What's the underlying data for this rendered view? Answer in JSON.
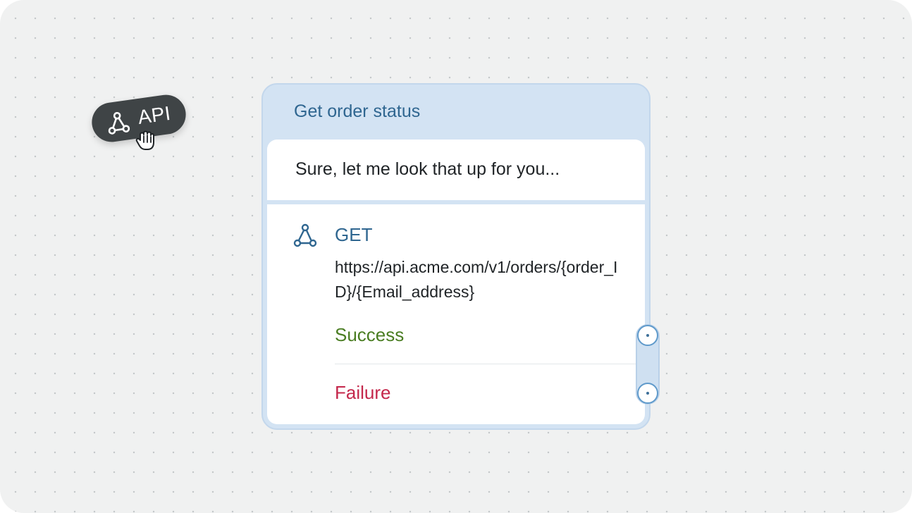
{
  "chip": {
    "label": "API",
    "icon": "api-webhook-icon"
  },
  "cursor": {
    "icon": "grab-hand-cursor-icon"
  },
  "node": {
    "title": "Get order status",
    "message": "Sure, let me look that up for you...",
    "api": {
      "icon": "api-webhook-icon",
      "method": "GET",
      "url": "https://api.acme.com/v1/orders/{order_ID}/{Email_address}"
    },
    "outcomes": {
      "success": "Success",
      "failure": "Failure"
    }
  },
  "colors": {
    "canvas": "#f0f1f1",
    "node_header": "#d3e3f3",
    "title": "#2f6690",
    "success": "#4a7d22",
    "failure": "#c4274b",
    "chip": "#3f4446"
  }
}
